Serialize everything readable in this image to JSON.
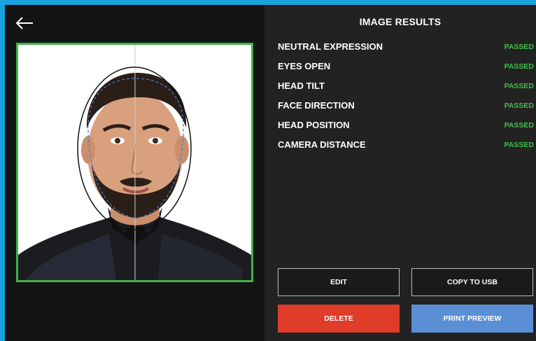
{
  "window": {
    "accent_color": "#1aa3e0"
  },
  "back_icon": "arrow-left-icon",
  "photo": {
    "frame_color": "#3fb24a",
    "description_icon": "portrait-photo"
  },
  "results": {
    "title": "IMAGE RESULTS",
    "pass_color": "#3fc04a",
    "items": [
      {
        "label": "NEUTRAL EXPRESSION",
        "status": "PASSED"
      },
      {
        "label": "EYES OPEN",
        "status": "PASSED"
      },
      {
        "label": "HEAD TILT",
        "status": "PASSED"
      },
      {
        "label": "FACE DIRECTION",
        "status": "PASSED"
      },
      {
        "label": "HEAD POSITION",
        "status": "PASSED"
      },
      {
        "label": "CAMERA DISTANCE",
        "status": "PASSED"
      }
    ]
  },
  "actions": {
    "edit": "EDIT",
    "copy_to_usb": "COPY TO USB",
    "delete": "DELETE",
    "print_preview": "PRINT PREVIEW",
    "delete_color": "#e03c2a",
    "print_color": "#5a8fd6"
  }
}
